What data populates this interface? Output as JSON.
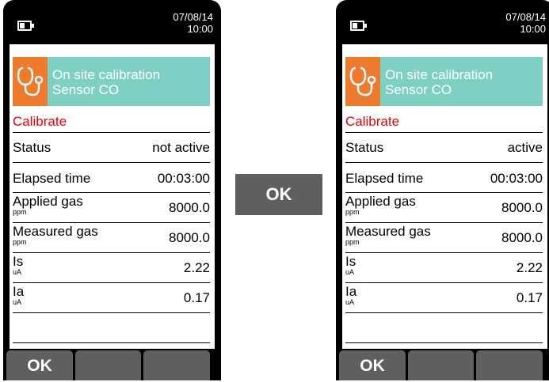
{
  "left": {
    "date": "07/08/14",
    "time": "10:00",
    "header": {
      "line1": "On site calibration",
      "line2": "Sensor CO",
      "icon": "stethoscope-icon"
    },
    "calibrate": "Calibrate",
    "status": {
      "label": "Status",
      "value": "not active"
    },
    "elapsed": {
      "label": "Elapsed time",
      "value": "00:03:00"
    },
    "applied": {
      "label": "Applied gas",
      "unit": "ppm",
      "value": "8000.0"
    },
    "measured": {
      "label": "Measured gas",
      "unit": "ppm",
      "value": "8000.0"
    },
    "is": {
      "label": "Is",
      "unit": "uA",
      "value": "2.22"
    },
    "ia": {
      "label": "Ia",
      "unit": "uA",
      "value": "0.17"
    },
    "softkeys": {
      "key1": "OK",
      "key2": "",
      "key3": ""
    }
  },
  "center_button": "OK",
  "right": {
    "date": "07/08/14",
    "time": "10:00",
    "header": {
      "line1": "On site calibration",
      "line2": "Sensor CO",
      "icon": "stethoscope-icon"
    },
    "calibrate": "Calibrate",
    "status": {
      "label": "Status",
      "value": "active"
    },
    "elapsed": {
      "label": "Elapsed time",
      "value": "00:03:00"
    },
    "applied": {
      "label": "Applied gas",
      "unit": "ppm",
      "value": "8000.0"
    },
    "measured": {
      "label": "Measured gas",
      "unit": "ppm",
      "value": "8000.0"
    },
    "is": {
      "label": "Is",
      "unit": "uA",
      "value": "2.22"
    },
    "ia": {
      "label": "Ia",
      "unit": "uA",
      "value": "0.17"
    },
    "softkeys": {
      "key1": "OK",
      "key2": "",
      "key3": ""
    }
  },
  "colors": {
    "header_bg": "#7ecfc4",
    "icon_bg": "#ee7a2d",
    "calibrate_text": "#e8000b",
    "softkey_bg": "#5f5f5f"
  }
}
